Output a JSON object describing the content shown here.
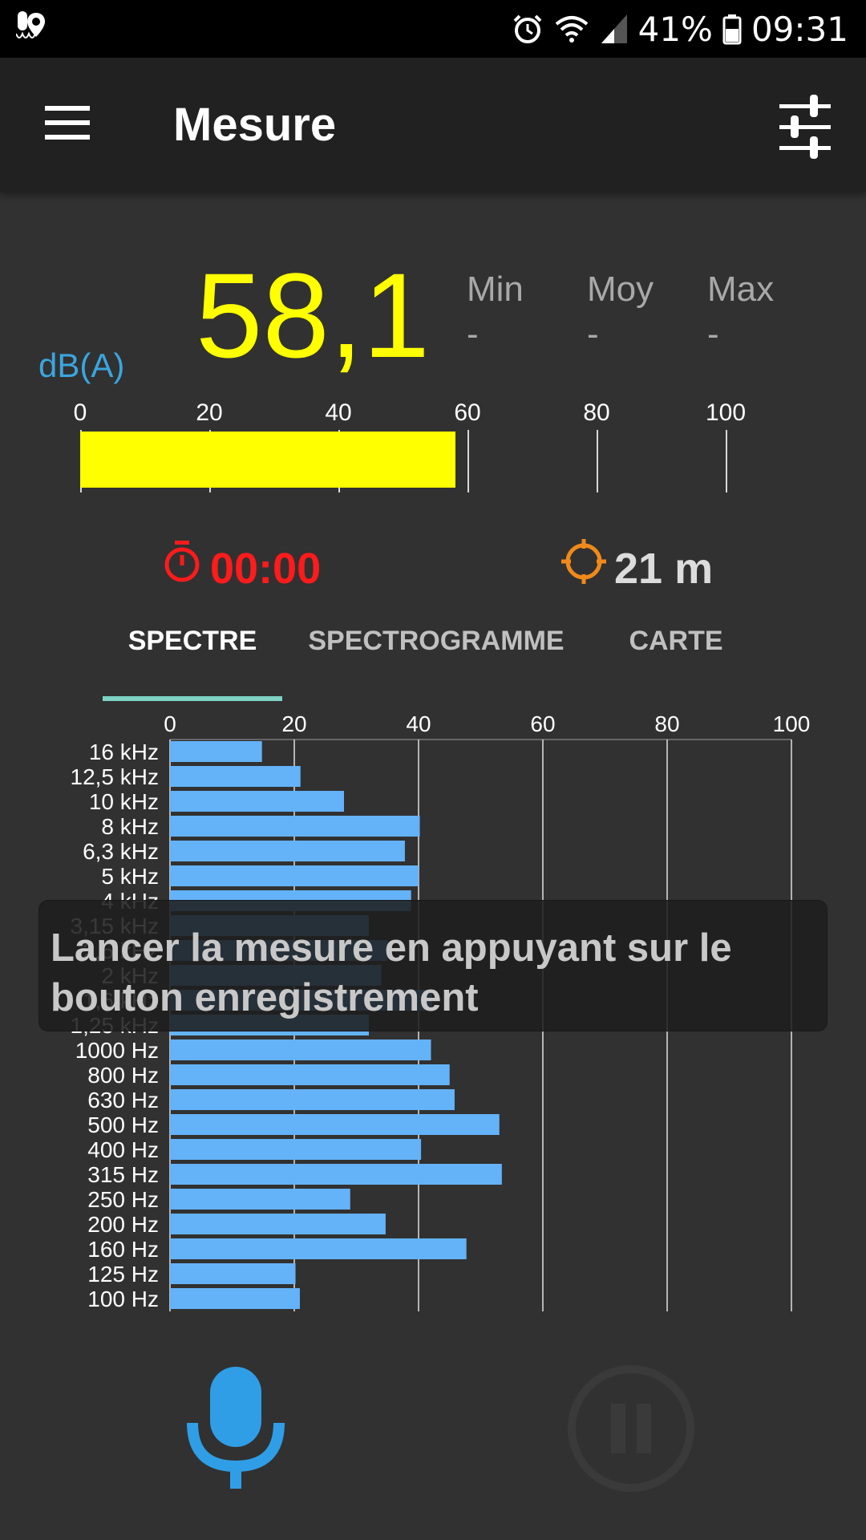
{
  "status_bar": {
    "battery": "41%",
    "time": "09:31"
  },
  "app_bar": {
    "title": "Mesure"
  },
  "level": {
    "value": "58,1",
    "value_numeric": 58.1,
    "unit": "dB(A)",
    "scale": {
      "min": 0,
      "max": 100,
      "ticks": [
        "0",
        "20",
        "40",
        "60",
        "80",
        "100"
      ]
    },
    "color": "#ffff00"
  },
  "stats": {
    "min": {
      "label": "Min",
      "value": "-"
    },
    "avg": {
      "label": "Moy",
      "value": "-"
    },
    "max": {
      "label": "Max",
      "value": "-"
    }
  },
  "timer": {
    "value": "00:00",
    "color": "#ff1b1b"
  },
  "gps": {
    "value": "21 m",
    "color": "#ef8a1a"
  },
  "tabs": [
    {
      "label": "SPECTRE",
      "selected": true
    },
    {
      "label": "SPECTROGRAMME",
      "selected": false
    },
    {
      "label": "CARTE",
      "selected": false
    }
  ],
  "toast": {
    "line1": "Lancer la mesure en appuyant sur le",
    "line2": "bouton enregistrement"
  },
  "chart_data": {
    "type": "bar",
    "orientation": "horizontal",
    "xlim": [
      0,
      100
    ],
    "xticks": [
      "0",
      "20",
      "40",
      "60",
      "80",
      "100"
    ],
    "categories": [
      "16 kHz",
      "12,5 kHz",
      "10 kHz",
      "8 kHz",
      "6,3 kHz",
      "5 kHz",
      "4 kHz",
      "3,15 kHz",
      "2,5 kHz",
      "2 kHz",
      "1,6 kHz",
      "1,25 kHz",
      "1000 Hz",
      "800 Hz",
      "630 Hz",
      "500 Hz",
      "400 Hz",
      "315 Hz",
      "250 Hz",
      "200 Hz",
      "160 Hz",
      "125 Hz",
      "100 Hz"
    ],
    "values": [
      14.8,
      21.0,
      28.0,
      40.2,
      37.8,
      40.0,
      38.8,
      32.0,
      35.0,
      34.0,
      42.2,
      32.0,
      42.0,
      45.0,
      45.8,
      53.0,
      40.4,
      53.4,
      29.0,
      34.7,
      47.7,
      20.2,
      20.9
    ],
    "bar_color": "#64b2f8",
    "grid": true
  },
  "icons": {
    "menu": "hamburger-menu-icon",
    "settings": "sliders-settings-icon",
    "timer": "stopwatch-icon",
    "gps": "gps-crosshair-icon",
    "mic": "microphone-icon",
    "pause": "pause-icon"
  }
}
